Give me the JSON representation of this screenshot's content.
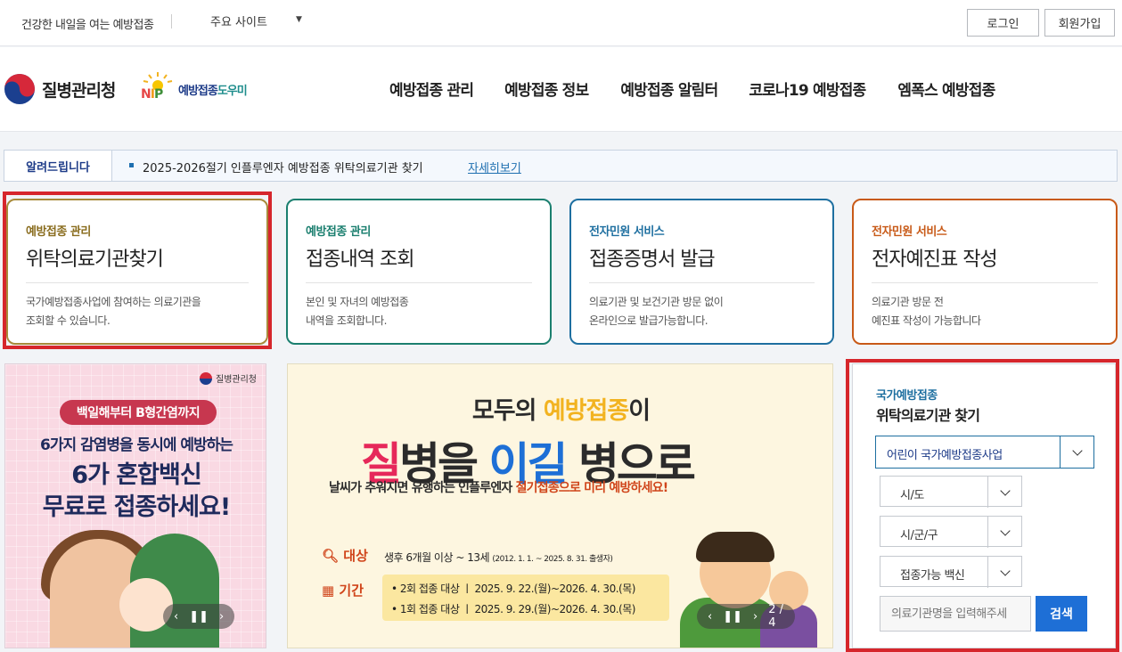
{
  "util": {
    "slogan": "건강한 내일을 여는 예방접종",
    "site_select": "주요 사이트",
    "login": "로그인",
    "join": "회원가입"
  },
  "header": {
    "agency": "질병관리청",
    "nip_letters": "NIP",
    "nip_text_a": "예방접종",
    "nip_text_b": "도우미",
    "menu": [
      "예방접종 관리",
      "예방접종 정보",
      "예방접종 알림터",
      "코로나19 예방접종",
      "엠폭스 예방접종"
    ]
  },
  "notice": {
    "label": "알려드립니다",
    "message": "2025-2026절기 인플루엔자 예방접종 위탁의료기관 찾기",
    "more": "자세히보기"
  },
  "cards": [
    {
      "category": "예방접종 관리",
      "title": "위탁의료기관찾기",
      "desc1": "국가예방접종사업에 참여하는 의료기관을",
      "desc2": "조회할 수 있습니다."
    },
    {
      "category": "예방접종 관리",
      "title": "접종내역 조회",
      "desc1": "본인 및 자녀의 예방접종",
      "desc2": "내역을 조회합니다."
    },
    {
      "category": "전자민원 서비스",
      "title": "접종증명서 발급",
      "desc1": "의료기관 및 보건기관 방문 없이",
      "desc2": "온라인으로 발급가능합니다."
    },
    {
      "category": "전자민원 서비스",
      "title": "전자예진표 작성",
      "desc1": "의료기관 방문 전",
      "desc2": "예진표 작성이 가능합니다"
    }
  ],
  "colors": {
    "card1": "#a88a3a",
    "card2": "#1b7f6f",
    "card3": "#1e6fa0",
    "card4": "#c85a18",
    "highlight": "#d6262c",
    "primary": "#1e6fd6"
  },
  "banner_left": {
    "org": "질병관리청",
    "pill": "백일해부터 B형간염까지",
    "line1": "6가지 감염병을 동시에 예방하는",
    "line2": "6가 혼합백신",
    "line3": "무료로 접종하세요!"
  },
  "banner_center": {
    "headline_a": "모두의 ",
    "headline_b": "예방접종",
    "headline_c": "이",
    "big_a": "질",
    "big_b": "병을 ",
    "big_c": "이길",
    "big_d": " 병으로",
    "sub_a": "날씨가 추워지면 유행하는 인플루엔자 ",
    "sub_b": "절기접종으로 미리 예방하세요!",
    "target_label": "대상",
    "target_text": "생후 6개월 이상 ~ 13세",
    "target_note": "(2012. 1. 1. ~ 2025. 8. 31. 출생자)",
    "period_label": "기간",
    "period_rows": [
      "• 2회 접종 대상 ㅣ 2025. 9. 22.(월)~2026. 4. 30.(목)",
      "• 1회 접종 대상 ㅣ 2025. 9. 29.(월)~2026. 4. 30.(목)"
    ],
    "page": "2 / 4"
  },
  "search": {
    "category": "국가예방접종",
    "title": "위탁의료기관 찾기",
    "program": "어린이 국가예방접종사업",
    "sido": "시/도",
    "sigungu": "시/군/구",
    "vaccine": "접종가능 백신",
    "placeholder": "의료기관명을 입력해주세",
    "button": "검색"
  }
}
